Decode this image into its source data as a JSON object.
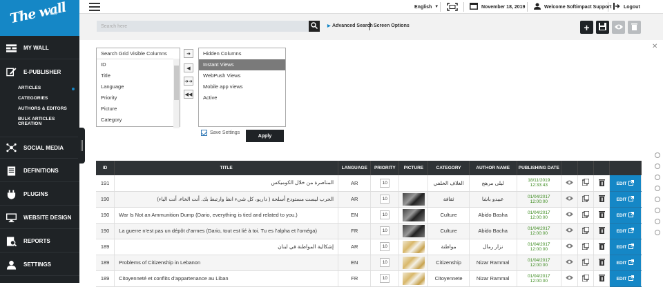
{
  "logo": {
    "text": "The wall",
    "sup": "360°"
  },
  "topbar": {
    "language": "English",
    "date": "November 18, 2019",
    "user": "Welcome Softimpact Support",
    "logout": "Logout"
  },
  "search": {
    "placeholder": "Search here",
    "advanced": "Advanced Search",
    "options": "Screen Options"
  },
  "sidebar": {
    "items": [
      {
        "label": "MY WALL",
        "icon": "wall-icon"
      },
      {
        "label": "E-PUBLISHER",
        "icon": "edit-icon"
      },
      {
        "label": "SOCIAL MEDIA",
        "icon": "share-icon"
      },
      {
        "label": "DEFINITIONS",
        "icon": "definitions-icon"
      },
      {
        "label": "PLUGINS",
        "icon": "plug-icon"
      },
      {
        "label": "WEBSITE DESIGN",
        "icon": "monitor-icon"
      },
      {
        "label": "REPORTS",
        "icon": "reports-icon"
      },
      {
        "label": "SETTINGS",
        "icon": "settings-icon"
      }
    ],
    "subitems": [
      "ARTICLES",
      "CATEGORIES",
      "AUTHORS & EDITORS",
      "BULK ARTICLES CREATION"
    ]
  },
  "columns_panel": {
    "visible_header": "Search Grid Visible Columns",
    "visible": [
      "ID",
      "Title",
      "Language",
      "Priority",
      "Picture",
      "Category"
    ],
    "hidden": [
      "Hidden Columns",
      "Instant Views",
      "WebPush Views",
      "Mobile app views",
      "Active"
    ],
    "save_label": "Save Settings",
    "apply_label": "Apply"
  },
  "grid": {
    "headers": [
      "ID",
      "TITLE",
      "LANGUAGE",
      "PRIORITY",
      "PICTURE",
      "CATEGORY",
      "AUTHOR NAME",
      "PUBLISHING DATE",
      "",
      "",
      "",
      ""
    ],
    "edit_label": "EDIT",
    "rows": [
      {
        "id": "191",
        "title": "المناصرة من خلال الكوميكس",
        "lang": "AR",
        "prio": "10",
        "pic": "none",
        "cat": "الغلاف الخلفي",
        "author": "ليلى مرهج",
        "date": "18/11/2019",
        "time": "12:33:43",
        "rtl": true
      },
      {
        "id": "190",
        "title": "الحرب ليست مستودع أسلحة ( داريو، كل شيء انظ وارتبط بك. أنت الخاء، أنت الياء)",
        "lang": "AR",
        "prio": "10",
        "pic": "bw",
        "cat": "ثقافة",
        "author": "عبيدو باشا",
        "date": "01/04/2017",
        "time": "12:00:00",
        "rtl": true
      },
      {
        "id": "190",
        "title": "War Is Not an Ammunition Dump (Dario, everything is tied and related to you.)",
        "lang": "EN",
        "prio": "10",
        "pic": "bw",
        "cat": "Culture",
        "author": "Abido Basha",
        "date": "01/04/2017",
        "time": "12:00:00",
        "rtl": false
      },
      {
        "id": "190",
        "title": "La guerre n’est pas un dépôt d’armes (Dario, tout est lié à toi. Tu es l’alpha et l’oméga)",
        "lang": "FR",
        "prio": "10",
        "pic": "bw",
        "cat": "Culture",
        "author": "Abido Bacha",
        "date": "01/04/2017",
        "time": "12:00:00",
        "rtl": false
      },
      {
        "id": "189",
        "title": "إشكالية المواطنة في لبنان",
        "lang": "AR",
        "prio": "10",
        "pic": "col",
        "cat": "مواطنة",
        "author": "نزار رمال",
        "date": "01/04/2017",
        "time": "12:00:00",
        "rtl": true
      },
      {
        "id": "189",
        "title": "Problems of Citizenship in Lebanon",
        "lang": "EN",
        "prio": "10",
        "pic": "col",
        "cat": "Citizenship",
        "author": "Nizar Rammal",
        "date": "01/04/2017",
        "time": "12:00:00",
        "rtl": false
      },
      {
        "id": "189",
        "title": "Citoyenneté et conflits d’appartenance au Liban",
        "lang": "FR",
        "prio": "10",
        "pic": "col",
        "cat": "Citoyennete",
        "author": "Nizar Rammal",
        "date": "01/04/2017",
        "time": "12:00:00",
        "rtl": false
      }
    ]
  },
  "colors": {
    "sidebar": "#1f2326",
    "accent": "#1587c6",
    "date_green": "#3a8a1c",
    "header": "#2f3336"
  }
}
